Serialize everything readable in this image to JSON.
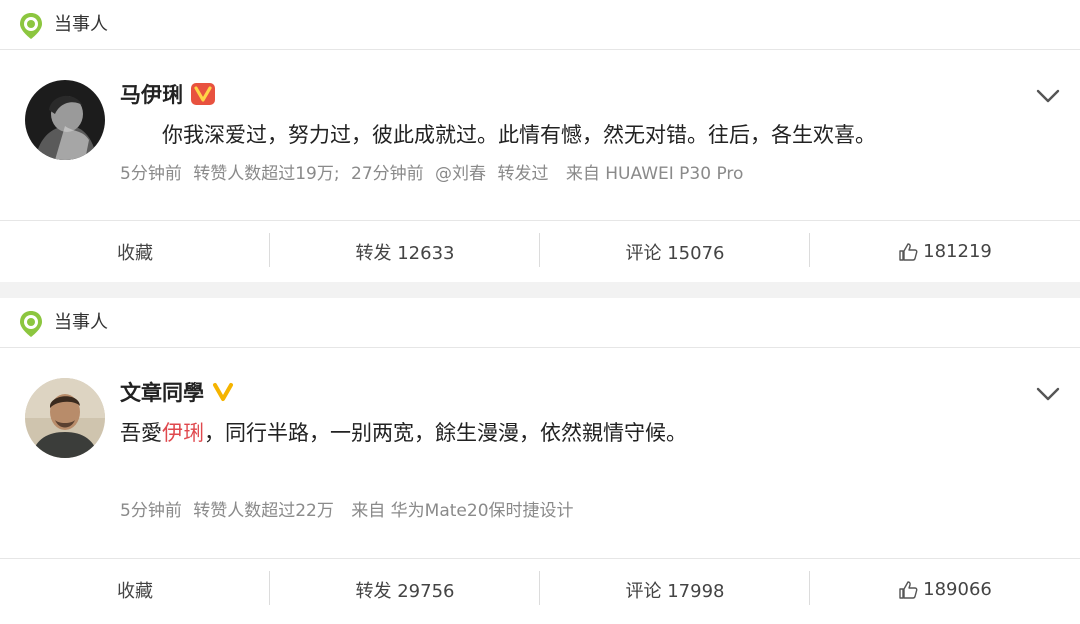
{
  "sections": [
    {
      "header": "当事人",
      "post": {
        "author": "马伊琍",
        "text": "你我深爱过，努力过，彼此成就过。此情有憾，然无对错。往后，各生欢喜。",
        "meta": {
          "time": "5分钟前",
          "stats": "转赞人数超过19万;",
          "repost_time": "27分钟前",
          "repost_user": "@刘春",
          "repost_label": "转发过",
          "source": "来自 HUAWEI P30 Pro"
        }
      },
      "actions": {
        "favorite": "收藏",
        "repost": "转发 12633",
        "comment": "评论 15076",
        "like": "181219"
      }
    },
    {
      "header": "当事人",
      "post": {
        "author": "文章同學",
        "text_prefix": "吾愛",
        "text_mention": "伊琍",
        "text_suffix": "，同行半路，一别两宽，餘生漫漫，依然親情守候。",
        "meta": {
          "time": "5分钟前",
          "stats": "转赞人数超过22万",
          "source": "来自 华为Mate20保时捷设计"
        }
      },
      "actions": {
        "favorite": "收藏",
        "repost": "转发 29756",
        "comment": "评论 17998",
        "like": "189066"
      }
    }
  ],
  "colors": {
    "accent_green": "#8cc63f",
    "vip_red": "#e8523f",
    "vip_gold": "#f5b400",
    "mention_red": "#e0484d"
  }
}
